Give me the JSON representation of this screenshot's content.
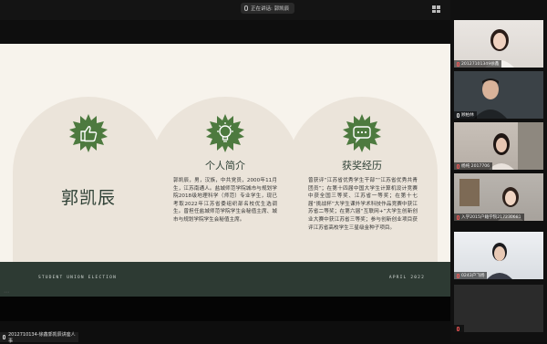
{
  "top_bar": {
    "speaking_label": "正在讲话: 郭凯辰"
  },
  "slide": {
    "name": "郭凯辰",
    "intro_heading": "个人简介",
    "intro_body": "郭凯辰，男，汉族，中共党员，2000年11月生，江苏南通人。盐城师范学院城市与规划学院2018级地理科学（师范）专业学生，现已考取2022年江苏省委组织部名校优生选调生。曾担任盐城师范学院学生会秘值主席、城市与规划学院学生会秘值主席。",
    "awards_heading": "获奖经历",
    "awards_body": "曾获评“江苏省优秀学生干部”“江苏省优秀共青团员”；在第十四届中国大学生计算机设计竞赛中获全国三等奖、江苏省一等奖；在第十七届“挑战杯”大学生课外学术科技作品竞赛中获江苏省二等奖；在第六届“互联网+”大学生创新创业大赛中获江苏省三等奖；参与创新创业项目获评江苏省高校学生三星级金种子项目。",
    "footer_left": "STUDENT UNION ELECTION",
    "footer_right": "APRIL 2022",
    "badge_color": "#4d7a3f",
    "accent_dark": "#2d3a33"
  },
  "bottom_label": "2012710134-徐鑫郭凯辰讲座人事",
  "participants": [
    {
      "label": "20127101349徐鑫",
      "mic": "off"
    },
    {
      "label": "顾柏林",
      "mic": "on"
    },
    {
      "label": "杨纯 2017706",
      "mic": "off"
    },
    {
      "label": "入学2015户籍学院217230681",
      "mic": "off"
    },
    {
      "label": "0243户飞杨",
      "mic": "off"
    },
    {
      "label": "",
      "mic": "off"
    }
  ]
}
